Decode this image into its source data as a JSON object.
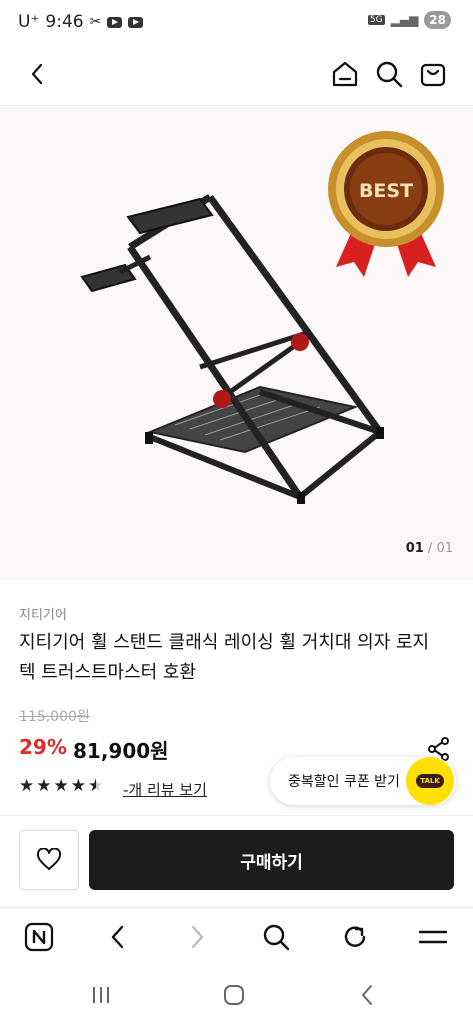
{
  "status_bar": {
    "carrier": "U⁺",
    "time": "9:46",
    "net": "5G",
    "battery": "28"
  },
  "header": {
    "back": "back",
    "icons": [
      "home-icon",
      "search-icon",
      "cart-icon"
    ]
  },
  "hero": {
    "badge_text": "BEST",
    "counter_current": "01",
    "counter_sep": " / ",
    "counter_total": "01"
  },
  "product": {
    "brand": "지티기어",
    "title": "지티기어 휠 스탠드 클래식 레이싱 휠 거치대 의자 로지텍 트러스트마스터 호환",
    "original_price": "115,000원",
    "discount": "29%",
    "price": "81,900원",
    "rating": 4.5,
    "review_link": "-개 리뷰 보기"
  },
  "coupon": {
    "label": "중복할인 쿠폰 받기",
    "talk": "TALK"
  },
  "actions": {
    "buy_label": "구매하기"
  },
  "colors": {
    "discount": "#e02b2b",
    "buy_button": "#1c1c1c",
    "kakao": "#ffe000",
    "badge_gold": "#c8902c",
    "ribbon": "#d92020"
  }
}
